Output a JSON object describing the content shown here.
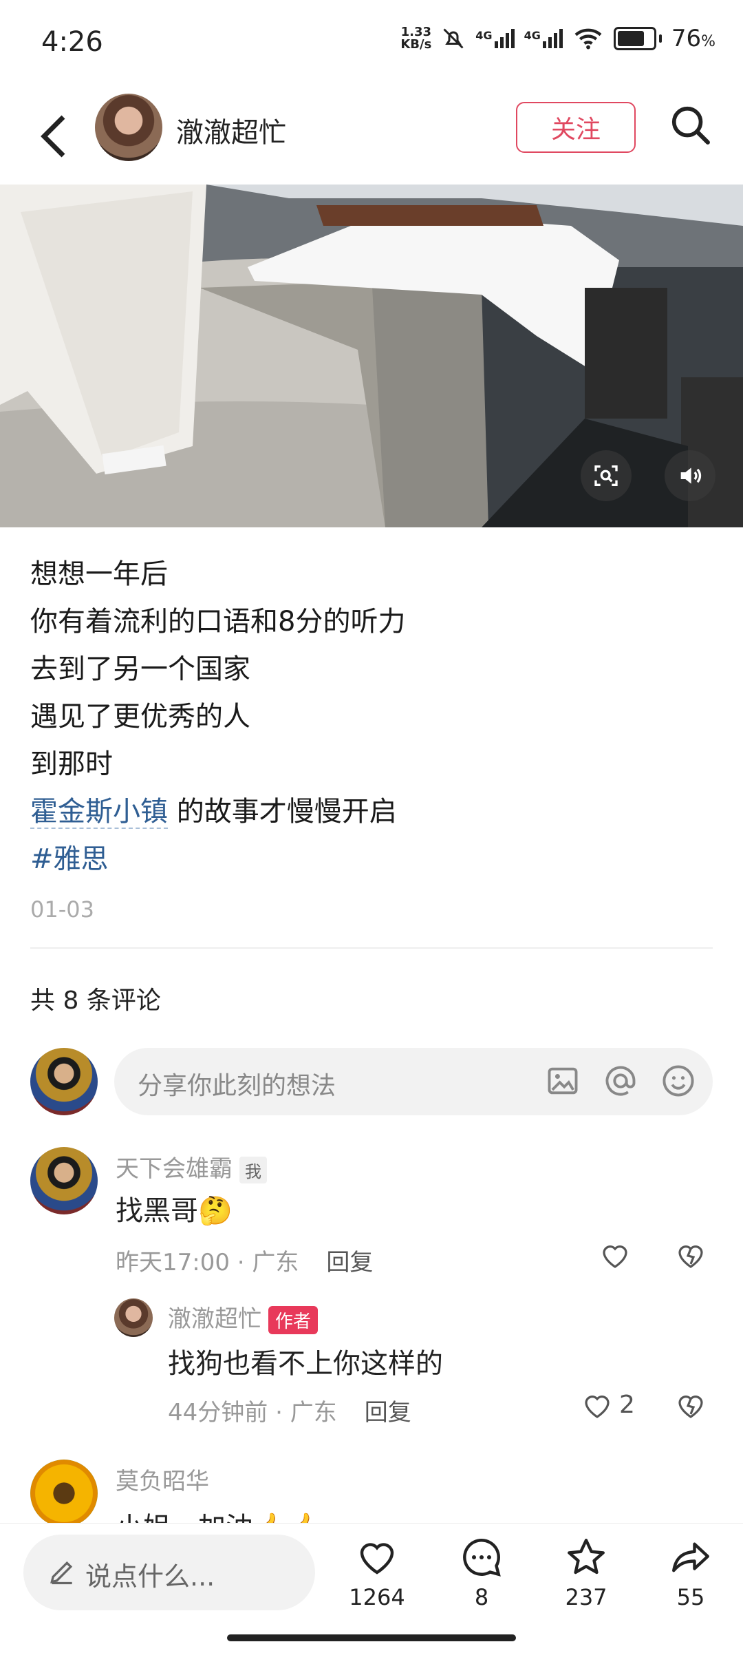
{
  "status_bar": {
    "time": "4:26",
    "net_speed_value": "1.33",
    "net_speed_unit": "KB/s",
    "signal1": "4G",
    "signal2": "4G",
    "battery_percent": "76",
    "battery_level": 0.76
  },
  "header": {
    "username": "澈澈超忙",
    "follow_label": "关注"
  },
  "video": {
    "scan_icon": "scan-icon",
    "volume_icon": "volume-icon"
  },
  "post": {
    "lines": [
      "想想一年后",
      "你有着流利的口语和8分的听力",
      "去到了另一个国家",
      "遇见了更优秀的人",
      "到那时"
    ],
    "link_text": "霍金斯小镇",
    "line_after_link": " 的故事才慢慢开启",
    "hashtag": "#雅思",
    "date": "01-03"
  },
  "comments_header": "共 8 条评论",
  "comment_input": {
    "placeholder": "分享你此刻的想法"
  },
  "comments": [
    {
      "name": "天下会雄霸",
      "badge": "我",
      "text": "找黑哥",
      "emoji": "🤔",
      "time": "昨天17:00",
      "location": "广东",
      "reply_label": "回复"
    },
    {
      "name": "澈澈超忙",
      "badge": "作者",
      "text": "找狗也看不上你这样的",
      "time": "44分钟前",
      "location": "广东",
      "reply_label": "回复",
      "likes": "2"
    },
    {
      "name": "莫负昭华",
      "text": "小姐，加油",
      "emoji": "👍👍"
    }
  ],
  "bottom_bar": {
    "say_placeholder": "说点什么...",
    "likes": "1264",
    "comments": "8",
    "favorites": "237",
    "shares": "55"
  }
}
